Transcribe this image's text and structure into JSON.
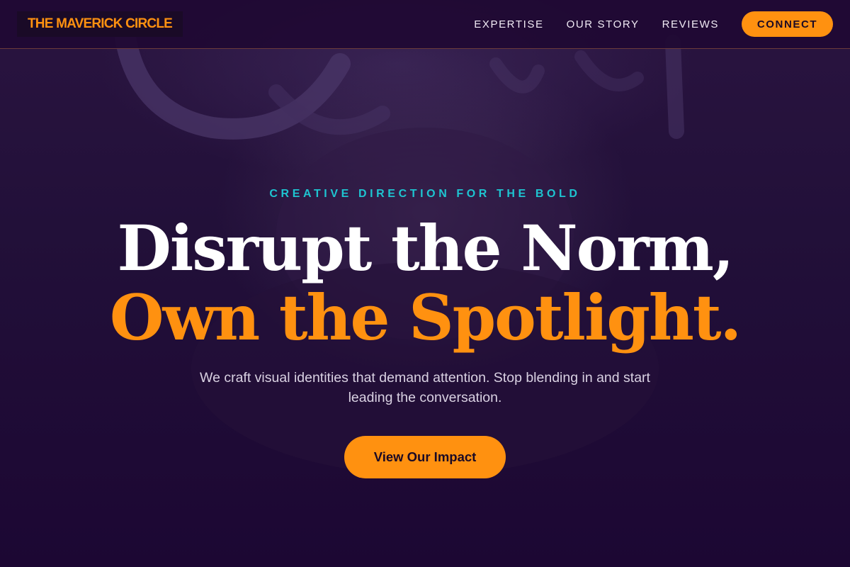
{
  "header": {
    "logo_text": "THE MAVERICK CIRCLE",
    "nav": [
      {
        "label": "EXPERTISE"
      },
      {
        "label": "OUR STORY"
      },
      {
        "label": "REVIEWS"
      }
    ],
    "connect_label": "CONNECT"
  },
  "hero": {
    "eyebrow": "CREATIVE DIRECTION FOR THE BOLD",
    "headline_line1": "Disrupt the Norm,",
    "headline_line2": "Own the Spotlight.",
    "subtext": "We craft visual identities that demand attention. Stop blending in and start leading the conversation.",
    "cta_label": "View Our Impact"
  },
  "colors": {
    "background": "#1f0933",
    "accent_orange": "#ff9110",
    "accent_cyan": "#1ec4d0",
    "divider": "#6b3b3a"
  }
}
